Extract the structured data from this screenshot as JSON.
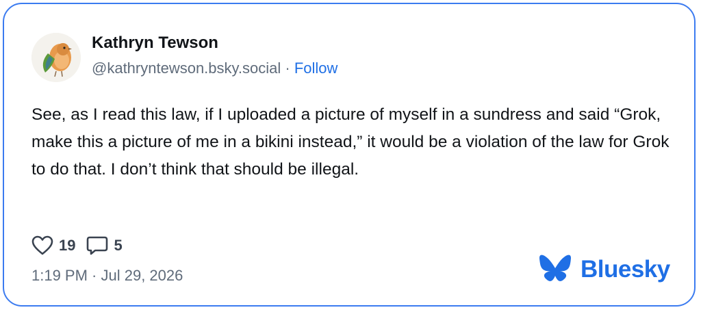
{
  "author": {
    "display_name": "Kathryn Tewson",
    "handle": "@kathryntewson.bsky.social",
    "separator": "·",
    "follow_label": "Follow",
    "avatar_icon": "bird-avatar-icon"
  },
  "post": {
    "text": "See, as I read this law, if I uploaded a picture of myself in a sundress and said “Grok, make this a picture of me in a bikini instead,” it would be a violation of the law for Grok to do that. I don’t think that should be illegal.",
    "likes": "19",
    "replies": "5",
    "timestamp": "1:19 PM · Jul 29, 2026"
  },
  "brand": {
    "name": "Bluesky",
    "color": "#1f6fe5"
  },
  "colors": {
    "border": "#3b7bf0",
    "text": "#111418",
    "muted": "#5f6b7a",
    "link": "#1f6fe5"
  }
}
